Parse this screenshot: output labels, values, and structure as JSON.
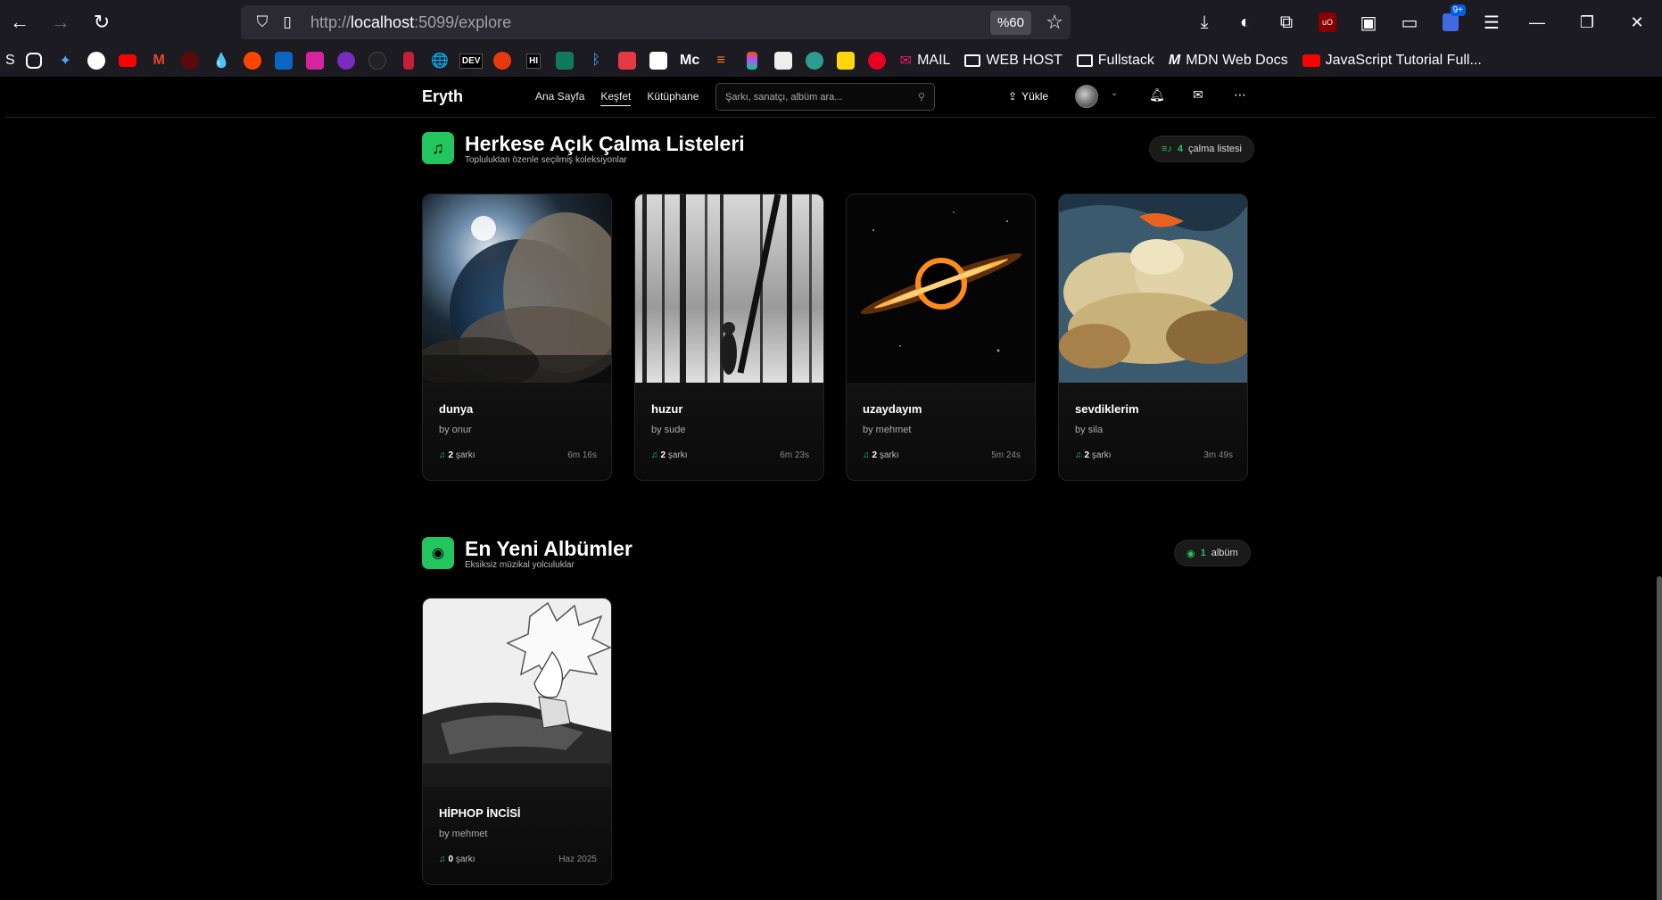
{
  "browser": {
    "url_prefix": "http://",
    "url_host": "localhost",
    "url_rest": ":5099/explore",
    "zoom": "%60",
    "ext_badge": "9+",
    "bookmarks_text": [
      "MAIL",
      "WEB HOST",
      "Fullstack",
      "MDN Web Docs",
      "JavaScript Tutorial Full..."
    ],
    "bookmark_first": "S"
  },
  "app": {
    "brand": "Eryth",
    "nav": [
      "Ana Sayfa",
      "Keşfet",
      "Kütüphane"
    ],
    "search_placeholder": "Şarkı, sanatçı, albüm ara...",
    "upload_label": "Yükle"
  },
  "playlists_section": {
    "title": "Herkese Açık Çalma Listeleri",
    "subtitle": "Topluluktan özenle seçilmiş koleksiyonlar",
    "count": "4",
    "count_label": "çalma listesi",
    "cards": [
      {
        "title": "dunya",
        "owner": "by onur",
        "songs": "2",
        "songs_label": "şarkı",
        "duration": "6m 16s"
      },
      {
        "title": "huzur",
        "owner": "by sude",
        "songs": "2",
        "songs_label": "şarkı",
        "duration": "6m 23s"
      },
      {
        "title": "uzaydayım",
        "owner": "by mehmet",
        "songs": "2",
        "songs_label": "şarkı",
        "duration": "5m 24s"
      },
      {
        "title": "sevdiklerim",
        "owner": "by sila",
        "songs": "2",
        "songs_label": "şarkı",
        "duration": "3m 49s"
      }
    ]
  },
  "albums_section": {
    "title": "En Yeni Albümler",
    "subtitle": "Eksiksiz müzikal yolculuklar",
    "count": "1",
    "count_label": "albüm",
    "cards": [
      {
        "title": "HİPHOP İNCİSİ",
        "owner": "by mehmet",
        "songs": "0",
        "songs_label": "şarkı",
        "date": "Haz 2025"
      }
    ]
  },
  "colors": {
    "accent": "#22c55e",
    "background": "#000000"
  }
}
